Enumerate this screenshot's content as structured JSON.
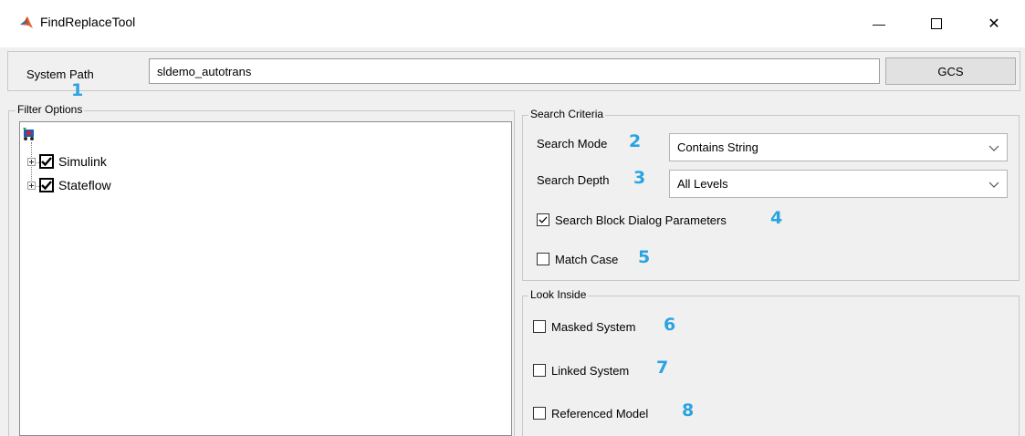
{
  "window": {
    "title": "FindReplaceTool",
    "minimize_glyph": "—",
    "close_glyph": "✕"
  },
  "path_row": {
    "label": "System Path",
    "value": "sldemo_autotrans",
    "gcs_label": "GCS",
    "badge": "1"
  },
  "filter": {
    "title": "Filter Options",
    "items": [
      {
        "label": "Simulink",
        "checked": true
      },
      {
        "label": "Stateflow",
        "checked": true
      }
    ]
  },
  "search": {
    "title": "Search Criteria",
    "mode_label": "Search Mode",
    "mode_badge": "2",
    "mode_value": "Contains String",
    "depth_label": "Search Depth",
    "depth_badge": "3",
    "depth_value": "All Levels",
    "block_dialog_label": "Search Block Dialog Parameters",
    "block_dialog_checked": true,
    "block_dialog_badge": "4",
    "match_case_label": "Match Case",
    "match_case_checked": false,
    "match_case_badge": "5"
  },
  "look_inside": {
    "title": "Look Inside",
    "items": [
      {
        "label": "Masked System",
        "checked": false,
        "badge": "6"
      },
      {
        "label": "Linked System",
        "checked": false,
        "badge": "7"
      },
      {
        "label": "Referenced Model",
        "checked": false,
        "badge": "8"
      }
    ]
  },
  "colors": {
    "badge": "#29a3e2",
    "window_bg": "#f0f0f0",
    "button_bg": "#e1e1e1"
  },
  "icons": {
    "app": "matlab-logo-icon",
    "tree_root": "simulink-model-icon"
  }
}
